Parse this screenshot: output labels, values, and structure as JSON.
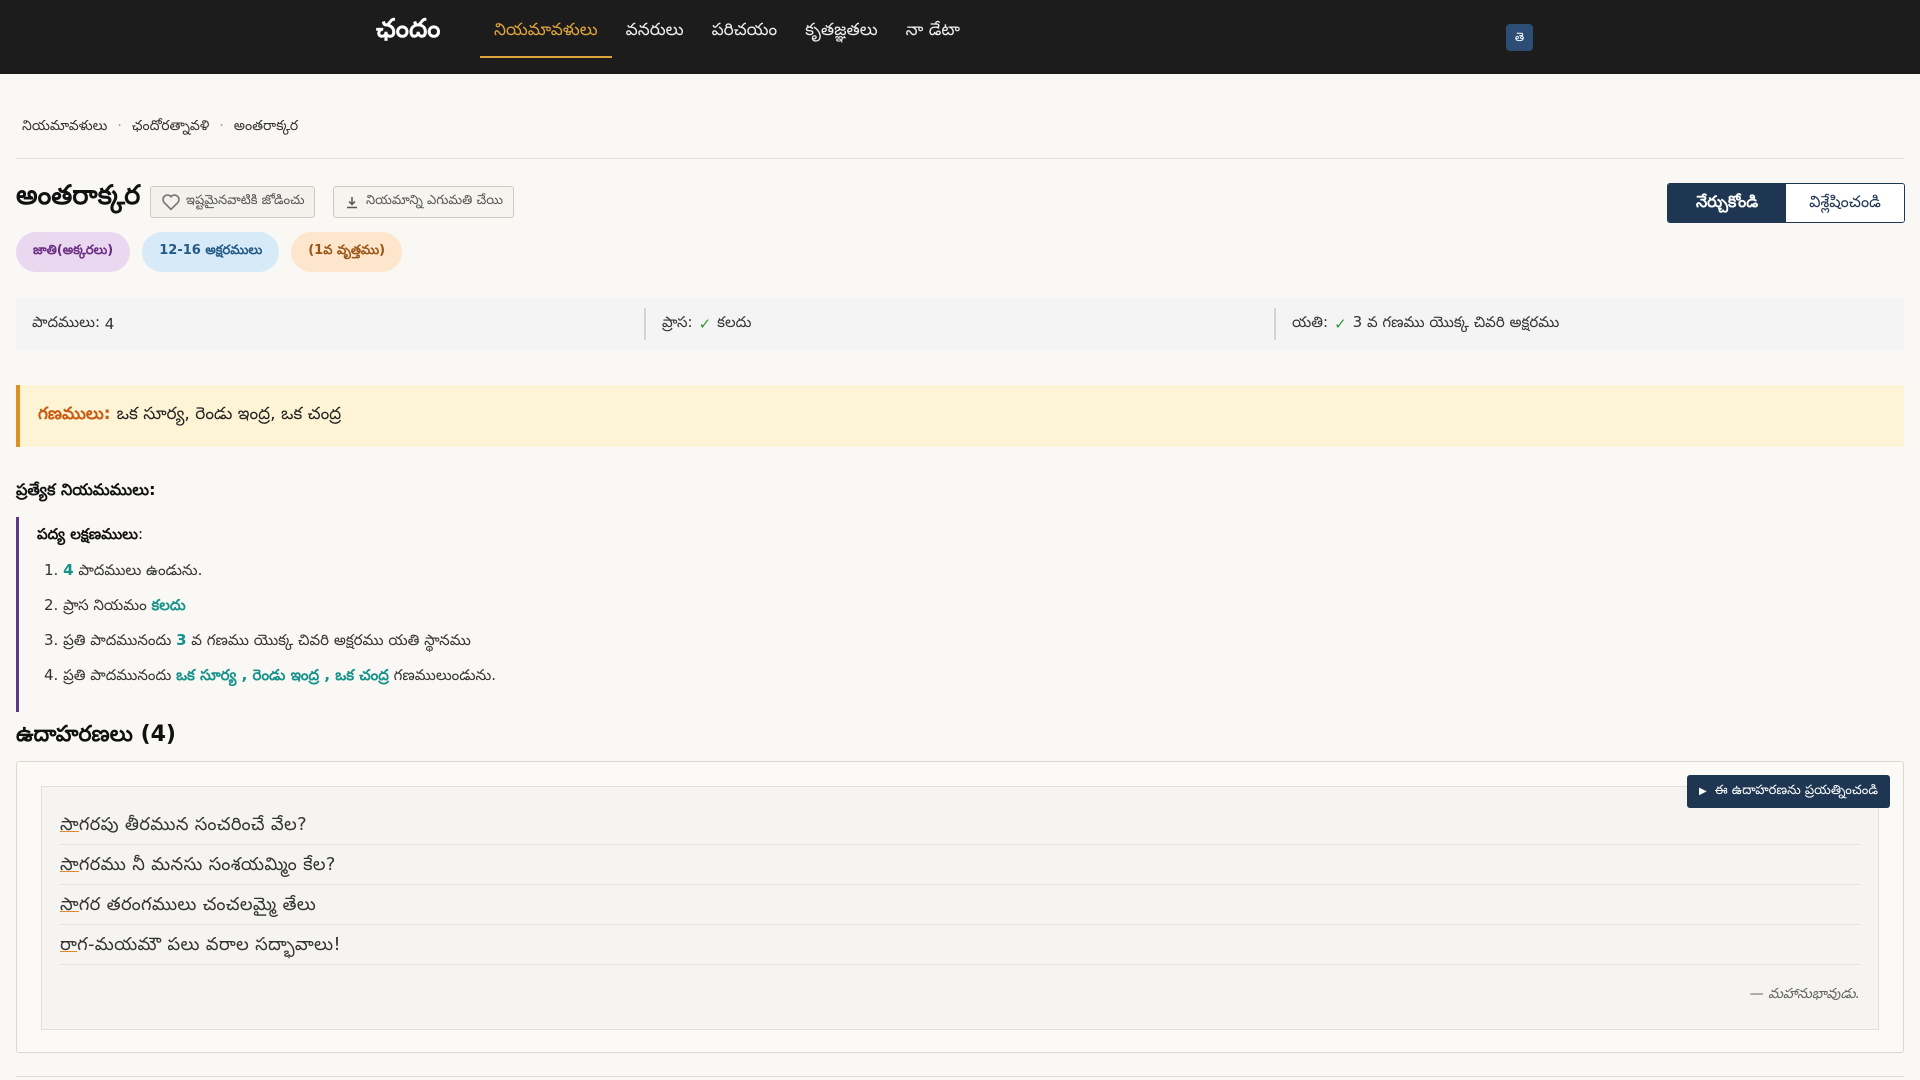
{
  "app": {
    "brand": "ఛందం",
    "nav": [
      {
        "label": "నియమావళులు",
        "active": true
      },
      {
        "label": "వనరులు",
        "active": false
      },
      {
        "label": "పరిచయం",
        "active": false
      },
      {
        "label": "కృతజ్ఞతలు",
        "active": false
      },
      {
        "label": "నా డేటా",
        "active": false
      }
    ],
    "lang_button": "తె"
  },
  "breadcrumb": [
    "నియమావళులు",
    "ఛందోరత్నావళి",
    "అంతరాక్కర"
  ],
  "page": {
    "title": "అంతరాక్కర",
    "fav_label": "ఇష్టమైనవాటికి జోడించు",
    "export_label": "నియమాన్ని ఎగుమతి చేయి",
    "mode_learn": "నేర్చుకోండి",
    "mode_analyze": "విశ్లేషించండి"
  },
  "tags": [
    "జాతి(అక్కరలు)",
    "12-16 అక్షరములు",
    "(1వ వృత్తము)"
  ],
  "info": {
    "padamulu_label": "పాదములు:",
    "padamulu_value": "4",
    "prasa_label": "ప్రాస:",
    "prasa_value": "కలదు",
    "yati_label": "యతి:",
    "yati_value": "3 వ గణము యొక్క చివరి అక్షరము",
    "check": "✓"
  },
  "gana": {
    "label": "గణములు:",
    "value": "ఒక సూర్య, రెండు ఇంద్ర, ఒక చంద్ర"
  },
  "rules": {
    "heading": "ప్రత్యేక నియమములు:",
    "title": "పద్య లక్షణములు",
    "colon": ":",
    "r1_num": "1.",
    "r1_hl": "4",
    "r1_text": "పాదములు ఉండును.",
    "r2_num": "2.",
    "r2_text": "ప్రాస నియమం",
    "r2_hl": "కలదు",
    "r3_num": "3.",
    "r3_pre": "ప్రతి పాదమునందు",
    "r3_hl": "3",
    "r3_text": "వ గణము యొక్క చివరి అక్షరము యతి స్థానము",
    "r4_num": "4.",
    "r4_pre": "ప్రతి పాదమునందు",
    "r4_hl": "ఒక సూర్య , రెండు ఇంద్ర , ఒక చంద్ర",
    "r4_text": "గణములుండును."
  },
  "examples": {
    "heading": "ఉదాహరణలు (4)",
    "try_label": "ఈ ఉదాహరణను ప్రయత్నించండి",
    "lines": [
      "సాగరపు తీరమున సంచరించే వేల?",
      "సాగరము నీ మనసు సంశయమ్మిం కేల?",
      "సాగర తరంగములు చంచలమ్మై తేలు",
      "రాగ-మయమౌ పలు వరాల సద్భావాలు!"
    ],
    "attribution": "— మహానుభావుడు."
  }
}
